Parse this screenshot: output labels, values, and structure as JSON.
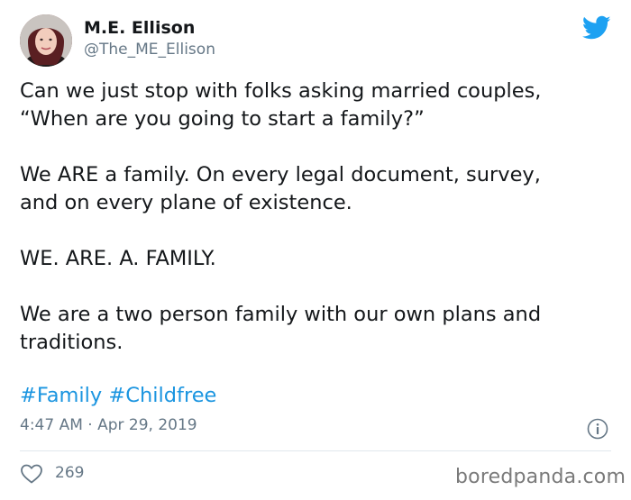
{
  "author": {
    "name": "M.E. Ellison",
    "handle": "@The_ME_Ellison"
  },
  "tweet": {
    "paragraphs": [
      "Can we just stop with folks asking married couples,\n“When are you going to start a family?”",
      "We ARE a family. On every legal document, survey,\nand on every plane of existence.",
      "WE. ARE. A. FAMILY.",
      "We are a two person family with our own plans and\ntraditions."
    ],
    "hashtags": [
      "#Family",
      "#Childfree"
    ],
    "timestamp": "4:47 AM · Apr 29, 2019"
  },
  "engagement": {
    "likes": "269"
  },
  "watermark": "boredpanda.com",
  "icons": {
    "brand": "twitter-bird-icon",
    "info": "info-icon",
    "like": "heart-icon"
  },
  "colors": {
    "twitter_blue": "#1da1f2",
    "hashtag": "#1b95e0",
    "secondary_text": "#657786",
    "divider": "#e1e8ed"
  }
}
